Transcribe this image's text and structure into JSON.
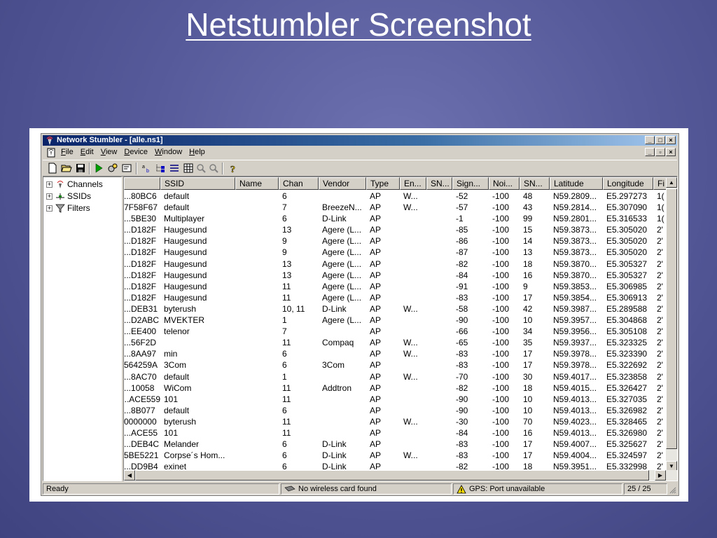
{
  "slide": {
    "title": "Netstumbler Screenshot"
  },
  "window": {
    "title": "Network Stumbler - [alle.ns1]",
    "buttons": {
      "minimize": "_",
      "maximize": "□",
      "restore": "▫",
      "close": "×"
    }
  },
  "menu": [
    "File",
    "Edit",
    "View",
    "Device",
    "Window",
    "Help"
  ],
  "tree": [
    "Channels",
    "SSIDs",
    "Filters"
  ],
  "columns": [
    "",
    "SSID",
    "Name",
    "Chan",
    "Vendor",
    "Type",
    "En...",
    "SN...",
    "Sign...",
    "Noi...",
    "SN...",
    "Latitude",
    "Longitude",
    "Fi"
  ],
  "rows": [
    [
      "80BC6...",
      "default",
      "",
      "6",
      "",
      "AP",
      "W...",
      "",
      "-52",
      "-100",
      "48",
      "N59.2809...",
      "E5.297273",
      "1("
    ],
    [
      "7F58F67",
      "default",
      "",
      "7",
      "BreezeN...",
      "AP",
      "W...",
      "",
      "-57",
      "-100",
      "43",
      "N59.2814...",
      "E5.307090",
      "1("
    ],
    [
      "5BE30...",
      "Multiplayer",
      "",
      "6",
      "D-Link",
      "AP",
      "",
      "",
      "-1",
      "-100",
      "99",
      "N59.2801...",
      "E5.316533",
      "1("
    ],
    [
      "D182F...",
      "Haugesund",
      "",
      "13",
      "Agere (L...",
      "AP",
      "",
      "",
      "-85",
      "-100",
      "15",
      "N59.3873...",
      "E5.305020",
      "2'"
    ],
    [
      "D182F...",
      "Haugesund",
      "",
      "9",
      "Agere (L...",
      "AP",
      "",
      "",
      "-86",
      "-100",
      "14",
      "N59.3873...",
      "E5.305020",
      "2'"
    ],
    [
      "D182F...",
      "Haugesund",
      "",
      "9",
      "Agere (L...",
      "AP",
      "",
      "",
      "-87",
      "-100",
      "13",
      "N59.3873...",
      "E5.305020",
      "2'"
    ],
    [
      "D182F...",
      "Haugesund",
      "",
      "13",
      "Agere (L...",
      "AP",
      "",
      "",
      "-82",
      "-100",
      "18",
      "N59.3870...",
      "E5.305327",
      "2'"
    ],
    [
      "D182F...",
      "Haugesund",
      "",
      "13",
      "Agere (L...",
      "AP",
      "",
      "",
      "-84",
      "-100",
      "16",
      "N59.3870...",
      "E5.305327",
      "2'"
    ],
    [
      "D182F...",
      "Haugesund",
      "",
      "11",
      "Agere (L...",
      "AP",
      "",
      "",
      "-91",
      "-100",
      "9",
      "N59.3853...",
      "E5.306985",
      "2'"
    ],
    [
      "D182F...",
      "Haugesund",
      "",
      "11",
      "Agere (L...",
      "AP",
      "",
      "",
      "-83",
      "-100",
      "17",
      "N59.3854...",
      "E5.306913",
      "2'"
    ],
    [
      "DEB31...",
      "byterush",
      "",
      "10, 11",
      "D-Link",
      "AP",
      "W...",
      "",
      "-58",
      "-100",
      "42",
      "N59.3987...",
      "E5.289588",
      "2'"
    ],
    [
      "D2ABC...",
      "MVEKTER",
      "",
      "1",
      "Agere (L...",
      "AP",
      "",
      "",
      "-90",
      "-100",
      "10",
      "N59.3957...",
      "E5.304868",
      "2'"
    ],
    [
      "EE400...",
      "telenor",
      "",
      "7",
      "",
      "AP",
      "",
      "",
      "-66",
      "-100",
      "34",
      "N59.3956...",
      "E5.305108",
      "2'"
    ],
    [
      "56F2D...",
      "",
      "",
      "11",
      "Compaq",
      "AP",
      "W...",
      "",
      "-65",
      "-100",
      "35",
      "N59.3937...",
      "E5.323325",
      "2'"
    ],
    [
      "8AA97...",
      "min",
      "",
      "6",
      "",
      "AP",
      "W...",
      "",
      "-83",
      "-100",
      "17",
      "N59.3978...",
      "E5.323390",
      "2'"
    ],
    [
      "564259A",
      "3Com",
      "",
      "6",
      "3Com",
      "AP",
      "",
      "",
      "-83",
      "-100",
      "17",
      "N59.3978...",
      "E5.322692",
      "2'"
    ],
    [
      "8AC70...",
      "default",
      "",
      "1",
      "",
      "AP",
      "W...",
      "",
      "-70",
      "-100",
      "30",
      "N59.4017...",
      "E5.323858",
      "2'"
    ],
    [
      "10058...",
      "WiCom",
      "",
      "11",
      "Addtron",
      "AP",
      "",
      "",
      "-82",
      "-100",
      "18",
      "N59.4015...",
      "E5.326427",
      "2'"
    ],
    [
      "ACE559...",
      "101",
      "",
      "11",
      "",
      "AP",
      "",
      "",
      "-90",
      "-100",
      "10",
      "N59.4013...",
      "E5.327035",
      "2'"
    ],
    [
      "8B077...",
      "default",
      "",
      "6",
      "",
      "AP",
      "",
      "",
      "-90",
      "-100",
      "10",
      "N59.4013...",
      "E5.326982",
      "2'"
    ],
    [
      "0000000",
      "byterush",
      "",
      "11",
      "",
      "AP",
      "W...",
      "",
      "-30",
      "-100",
      "70",
      "N59.4023...",
      "E5.328465",
      "2'"
    ],
    [
      "ACE55...",
      "101",
      "",
      "11",
      "",
      "AP",
      "",
      "",
      "-84",
      "-100",
      "16",
      "N59.4013...",
      "E5.326980",
      "2'"
    ],
    [
      "DEB4C...",
      "Melander",
      "",
      "6",
      "D-Link",
      "AP",
      "",
      "",
      "-83",
      "-100",
      "17",
      "N59.4007...",
      "E5.325627",
      "2'"
    ],
    [
      "5BE5221",
      "Corpse´s Hom...",
      "",
      "6",
      "D-Link",
      "AP",
      "W...",
      "",
      "-83",
      "-100",
      "17",
      "N59.4004...",
      "E5.324597",
      "2'"
    ],
    [
      "DD9B4...",
      "exinet",
      "",
      "6",
      "D-Link",
      "AP",
      "",
      "",
      "-82",
      "-100",
      "18",
      "N59.3951...",
      "E5.332998",
      "2'"
    ]
  ],
  "status": {
    "ready": "Ready",
    "card": "No wireless card found",
    "gps": "GPS: Port unavailable",
    "count": "25 / 25"
  },
  "colors": {
    "titlebar": "#0a246a",
    "face": "#d4d0c8",
    "slide_bg": "#565a9a"
  }
}
